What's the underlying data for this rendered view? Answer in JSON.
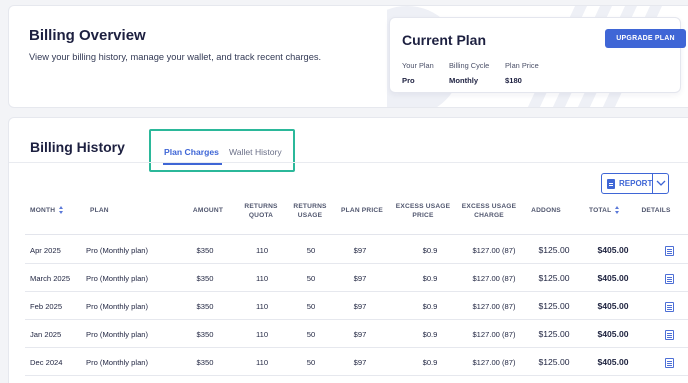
{
  "overview": {
    "title": "Billing Overview",
    "subtitle": "View your billing history, manage your wallet, and track recent charges."
  },
  "current_plan": {
    "title": "Current Plan",
    "upgrade_label": "UPGRADE PLAN",
    "fields": [
      {
        "label": "Your Plan",
        "value": "Pro"
      },
      {
        "label": "Billing Cycle",
        "value": "Monthly"
      },
      {
        "label": "Plan Price",
        "value": "$180"
      }
    ]
  },
  "history": {
    "title": "Billing History",
    "tabs": [
      {
        "label": "Plan Charges",
        "active": true
      },
      {
        "label": "Wallet History",
        "active": false
      }
    ],
    "report_label": "REPORT",
    "columns": {
      "month": "MONTH",
      "plan": "PLAN",
      "amount": "AMOUNT",
      "returns_quota_1": "RETURNS",
      "returns_quota_2": "QUOTA",
      "returns_usage_1": "RETURNS",
      "returns_usage_2": "USAGE",
      "plan_price": "PLAN PRICE",
      "excess_price_1": "EXCESS USAGE",
      "excess_price_2": "PRICE",
      "excess_charge_1": "EXCESS USAGE",
      "excess_charge_2": "CHARGE",
      "addons": "ADDONS",
      "total": "TOTAL",
      "details": "DETAILS"
    },
    "rows": [
      {
        "month": "Apr 2025",
        "plan": "Pro (Monthly plan)",
        "amount": "$350",
        "quota": "110",
        "usage": "50",
        "plan_price": "$97",
        "excess_price": "$0.9",
        "excess_charge": "$127.00 (87)",
        "addons": "$125.00",
        "total": "$405.00"
      },
      {
        "month": "March 2025",
        "plan": "Pro (Monthly plan)",
        "amount": "$350",
        "quota": "110",
        "usage": "50",
        "plan_price": "$97",
        "excess_price": "$0.9",
        "excess_charge": "$127.00 (87)",
        "addons": "$125.00",
        "total": "$405.00"
      },
      {
        "month": "Feb 2025",
        "plan": "Pro (Monthly plan)",
        "amount": "$350",
        "quota": "110",
        "usage": "50",
        "plan_price": "$97",
        "excess_price": "$0.9",
        "excess_charge": "$127.00 (87)",
        "addons": "$125.00",
        "total": "$405.00"
      },
      {
        "month": "Jan 2025",
        "plan": "Pro (Monthly plan)",
        "amount": "$350",
        "quota": "110",
        "usage": "50",
        "plan_price": "$97",
        "excess_price": "$0.9",
        "excess_charge": "$127.00 (87)",
        "addons": "$125.00",
        "total": "$405.00"
      },
      {
        "month": "Dec 2024",
        "plan": "Pro (Monthly plan)",
        "amount": "$350",
        "quota": "110",
        "usage": "50",
        "plan_price": "$97",
        "excess_price": "$0.9",
        "excess_charge": "$127.00 (87)",
        "addons": "$125.00",
        "total": "$405.00"
      }
    ]
  },
  "colors": {
    "accent": "#3f66d6",
    "highlight": "#2bb89a"
  },
  "icons": {
    "report": "document-icon",
    "dropdown": "chevron-down-icon",
    "details": "receipt-icon",
    "sort": "sort-icon"
  }
}
